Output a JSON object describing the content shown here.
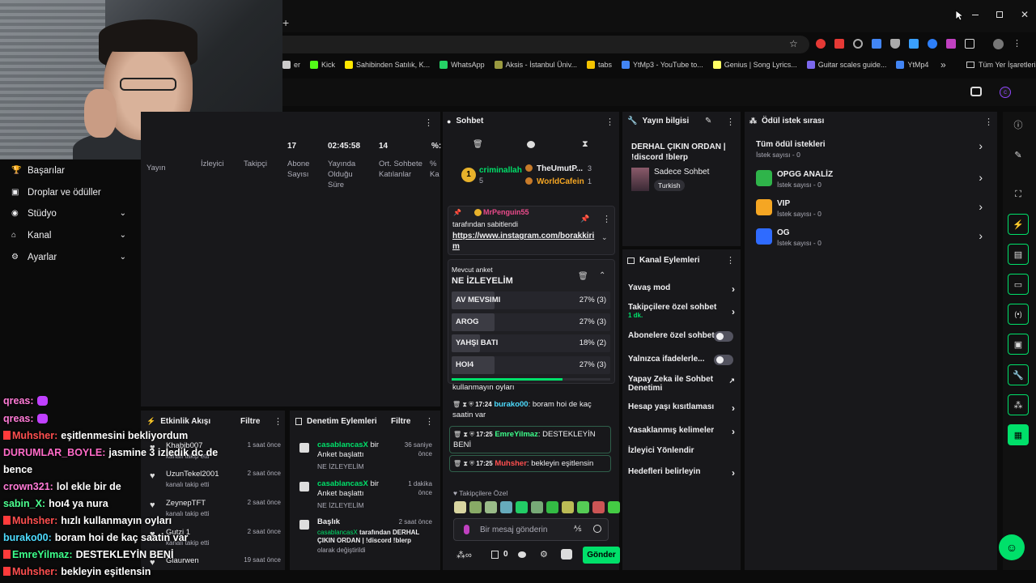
{
  "browser": {
    "bookmarks": [
      {
        "label": "er",
        "color": "#cccccc"
      },
      {
        "label": "Kick",
        "color": "#53fc18"
      },
      {
        "label": "Sahibinden Satılık, K...",
        "color": "#ffe800"
      },
      {
        "label": "WhatsApp",
        "color": "#25d366"
      },
      {
        "label": "Aksis - İstanbul Üniv...",
        "color": "#9a9a40"
      },
      {
        "label": "tabs",
        "color": "#f3c300"
      },
      {
        "label": "YtMp3 - YouTube to...",
        "color": "#4285f4"
      },
      {
        "label": "Genius | Song Lyrics...",
        "color": "#ffff64"
      },
      {
        "label": "Guitar scales guide...",
        "color": "#7b68ee"
      },
      {
        "label": "YtMp4",
        "color": "#4285f4"
      }
    ],
    "bookmarks_overflow": "»",
    "all_bookmarks": "Tüm Yer İşaretleri"
  },
  "leftnav": {
    "items": [
      {
        "label": "Başarılar",
        "icon": "trophy-icon",
        "chev": false
      },
      {
        "label": "Droplar ve ödüller",
        "icon": "gift-icon",
        "chev": false
      },
      {
        "label": "Stüdyo",
        "icon": "studio-icon",
        "chev": true
      },
      {
        "label": "Kanal",
        "icon": "channel-icon",
        "chev": true
      },
      {
        "label": "Ayarlar",
        "icon": "gear-icon",
        "chev": true
      }
    ]
  },
  "stats": {
    "values": [
      "17",
      "02:45:58",
      "14",
      "%:"
    ],
    "labels": [
      "Yayın",
      "İzleyici",
      "Takipçi",
      "Abone Sayısı",
      "Yayında Olduğu Süre",
      "Ort. Sohbete Katılanlar",
      "% Ka"
    ]
  },
  "overlay_chat": [
    {
      "user": "qreas:",
      "text": "",
      "color": "#ff7ad6",
      "badge": false
    },
    {
      "user": "qreas:",
      "text": "",
      "color": "#ff7ad6",
      "badge": false
    },
    {
      "user": "Muhsher:",
      "text": "eşitlenmesini bekliyordum",
      "color": "#ff4f4f",
      "badge": true
    },
    {
      "user": "DURUMLAR_BOYLE:",
      "text": "jasmine 3 izledik dc de",
      "color": "#ff6bc8",
      "badge": false
    },
    {
      "user": "",
      "text": "bence",
      "color": "#ffffff",
      "badge": false
    },
    {
      "user": "crown321:",
      "text": "lol ekle bir de",
      "color": "#ff7ad6",
      "badge": false
    },
    {
      "user": "sabin_X:",
      "text": "hoı4 ya nura",
      "color": "#4cff8f",
      "badge": false
    },
    {
      "user": "Muhsher:",
      "text": "hızlı kullanmayın oyları",
      "color": "#ff4f4f",
      "badge": true
    },
    {
      "user": "burako00:",
      "text": "boram hoi de kaç saatin var",
      "color": "#4ddcff",
      "badge": false
    },
    {
      "user": "EmreYilmaz:",
      "text": "DESTEKLEYİN BENİ",
      "color": "#3dff8b",
      "badge": true
    },
    {
      "user": "Muhsher:",
      "text": "bekleyin eşitlensin",
      "color": "#ff4f4f",
      "badge": true
    }
  ],
  "activity_feed": {
    "title": "Etkinlik Akışı",
    "filter": "Filtre",
    "items": [
      {
        "name": "Khabib007",
        "sub": "kanalı takip etti",
        "time": "1 saat önce"
      },
      {
        "name": "UzunTekel2001",
        "sub": "kanalı takip etti",
        "time": "2 saat önce"
      },
      {
        "name": "ZeynepTFT",
        "sub": "kanalı takip etti",
        "time": "2 saat önce"
      },
      {
        "name": "Gutzi 1",
        "sub": "kanalı takip etti",
        "time": "2 saat önce"
      },
      {
        "name": "Glaurwen",
        "sub": "",
        "time": "19 saat önce"
      }
    ]
  },
  "mod_actions": {
    "title": "Denetim Eylemleri",
    "filter": "Filtre",
    "items": [
      {
        "user": "casablancasX",
        "action": "bir Anket başlattı",
        "sub": "NE İZLEYELİM",
        "time": "36 saniye önce"
      },
      {
        "user": "casablancasX",
        "action": "bir Anket başlattı",
        "sub": "NE İZLEYELİM",
        "time": "1 dakika önce"
      },
      {
        "user": "Başlık",
        "action": "",
        "sub2user": "casablancasX",
        "sub2": "tarafından DERHAL ÇIKIN ORDAN | !discord !blerp",
        "sub3": "olarak değiştirildi",
        "time": "2 saat önce"
      }
    ]
  },
  "chat": {
    "title": "Sohbet",
    "leaders": [
      {
        "rank": "1",
        "name": "criminallah",
        "count": "5"
      },
      {
        "name": "TheUmutP...",
        "count": "3"
      },
      {
        "name": "WorldCafein",
        "count": "1"
      }
    ],
    "pinned": {
      "user": "MrPenguin55",
      "by": "tarafından sabitlendi",
      "link": "https://www.instagram.com/borakkirim"
    },
    "poll": {
      "label": "Mevcut anket",
      "title": "NE İZLEYELİM",
      "options": [
        {
          "label": "AV MEVSIMI",
          "result": "27% (3)",
          "pct": 27
        },
        {
          "label": "AROG",
          "result": "27% (3)",
          "pct": 27
        },
        {
          "label": "YAHŞI BATI",
          "result": "18% (2)",
          "pct": 18
        },
        {
          "label": "HOI4",
          "result": "27% (3)",
          "pct": 27
        }
      ],
      "progress": 0.7
    },
    "partial_msg": "kullanmayın oyları",
    "messages": [
      {
        "time": "17:24",
        "user": "burako00",
        "text": "boram hoi de kaç saatin var",
        "color": "#4ddcff"
      },
      {
        "time": "17:25",
        "user": "EmreYilmaz",
        "text": "DESTEKLEYİN BENİ",
        "color": "#3dff8b"
      },
      {
        "time": "17:25",
        "user": "Muhsher",
        "text": "bekleyin eşitlensin",
        "color": "#ff4f4f"
      }
    ],
    "followers_only": "Takipçilere Özel",
    "placeholder": "Bir mesaj gönderin",
    "points": "0",
    "send": "Gönder"
  },
  "stream_info": {
    "title": "Yayın bilgisi",
    "stream_title": "DERHAL ÇIKIN ORDAN | !discord !blerp",
    "category": "Sadece Sohbet",
    "tag": "Turkish"
  },
  "channel_actions": {
    "title": "Kanal Eylemleri",
    "items": [
      {
        "label": "Yavaş mod",
        "type": "arrow"
      },
      {
        "label": "Takipçilere özel sohbet",
        "sub": "1 dk.",
        "type": "arrow"
      },
      {
        "label": "Abonelere özel sohbet",
        "type": "toggle"
      },
      {
        "label": "Yalnızca ifadelerle...",
        "type": "toggle"
      },
      {
        "label": "Yapay Zeka ile Sohbet Denetimi",
        "type": "external"
      },
      {
        "label": "Hesap yaşı kısıtlaması",
        "type": "arrow"
      },
      {
        "label": "Yasaklanmış kelimeler",
        "type": "arrow"
      },
      {
        "label": "İzleyici Yönlendir",
        "type": "none"
      },
      {
        "label": "Hedefleri belirleyin",
        "type": "arrow"
      }
    ]
  },
  "rewards": {
    "title": "Ödül istek sırası",
    "items": [
      {
        "name": "Tüm ödül istekleri",
        "sub": "İstek sayısı - 0",
        "color": ""
      },
      {
        "name": "OPGG ANALİZ",
        "sub": "İstek sayısı - 0",
        "color": "#2fb44a"
      },
      {
        "name": "VIP",
        "sub": "İstek sayısı - 0",
        "color": "#f5a623"
      },
      {
        "name": "OG",
        "sub": "İstek sayısı - 0",
        "color": "#2f6bff"
      }
    ]
  },
  "colors": {
    "accent": "#00e06a",
    "panel": "#18181b",
    "bg": "#0b0b0b"
  }
}
